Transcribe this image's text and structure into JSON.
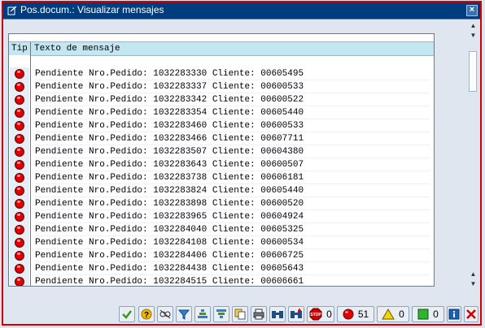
{
  "window": {
    "title": "Pos.docum.: Visualizar mensajes",
    "close_glyph": "×"
  },
  "list": {
    "col_type": "Tip",
    "col_message": "Texto de mensaje",
    "rows": [
      {
        "type": "error",
        "text": "Pendiente Nro.Pedido: 1032283330 Cliente: 00605495"
      },
      {
        "type": "error",
        "text": "Pendiente Nro.Pedido: 1032283337 Cliente: 00600533"
      },
      {
        "type": "error",
        "text": "Pendiente Nro.Pedido: 1032283342 Cliente: 00600522"
      },
      {
        "type": "error",
        "text": "Pendiente Nro.Pedido: 1032283354 Cliente: 00605440"
      },
      {
        "type": "error",
        "text": "Pendiente Nro.Pedido: 1032283460 Cliente: 00600533"
      },
      {
        "type": "error",
        "text": "Pendiente Nro.Pedido: 1032283466 Cliente: 00607711"
      },
      {
        "type": "error",
        "text": "Pendiente Nro.Pedido: 1032283507 Cliente: 00604380"
      },
      {
        "type": "error",
        "text": "Pendiente Nro.Pedido: 1032283643 Cliente: 00600507"
      },
      {
        "type": "error",
        "text": "Pendiente Nro.Pedido: 1032283738 Cliente: 00606181"
      },
      {
        "type": "error",
        "text": "Pendiente Nro.Pedido: 1032283824 Cliente: 00605440"
      },
      {
        "type": "error",
        "text": "Pendiente Nro.Pedido: 1032283898 Cliente: 00600520"
      },
      {
        "type": "error",
        "text": "Pendiente Nro.Pedido: 1032283965 Cliente: 00604924"
      },
      {
        "type": "error",
        "text": "Pendiente Nro.Pedido: 1032284040 Cliente: 00605325"
      },
      {
        "type": "error",
        "text": "Pendiente Nro.Pedido: 1032284108 Cliente: 00600534"
      },
      {
        "type": "error",
        "text": "Pendiente Nro.Pedido: 1032284406 Cliente: 00606725"
      },
      {
        "type": "error",
        "text": "Pendiente Nro.Pedido: 1032284438 Cliente: 00605643"
      },
      {
        "type": "error",
        "text": "Pendiente Nro.Pedido: 1032284515 Cliente: 00606661"
      }
    ]
  },
  "toolbar": {
    "buttons": [
      "check-icon",
      "help-icon",
      "where-used-icon",
      "filter-icon",
      "sort-ascending-icon",
      "sort-descending-icon",
      "copy-icon",
      "print-icon",
      "find-icon",
      "find-next-icon"
    ],
    "stop_count": "0",
    "error_count": "51",
    "warning_count": "0",
    "success_count": "0",
    "info_icon": "info-icon",
    "cancel_icon": "cancel-icon"
  },
  "colors": {
    "title_bar": "#003d7e",
    "header_row": "#c4e6f1",
    "error_red": "#e00000",
    "frame_border": "#d40000"
  }
}
